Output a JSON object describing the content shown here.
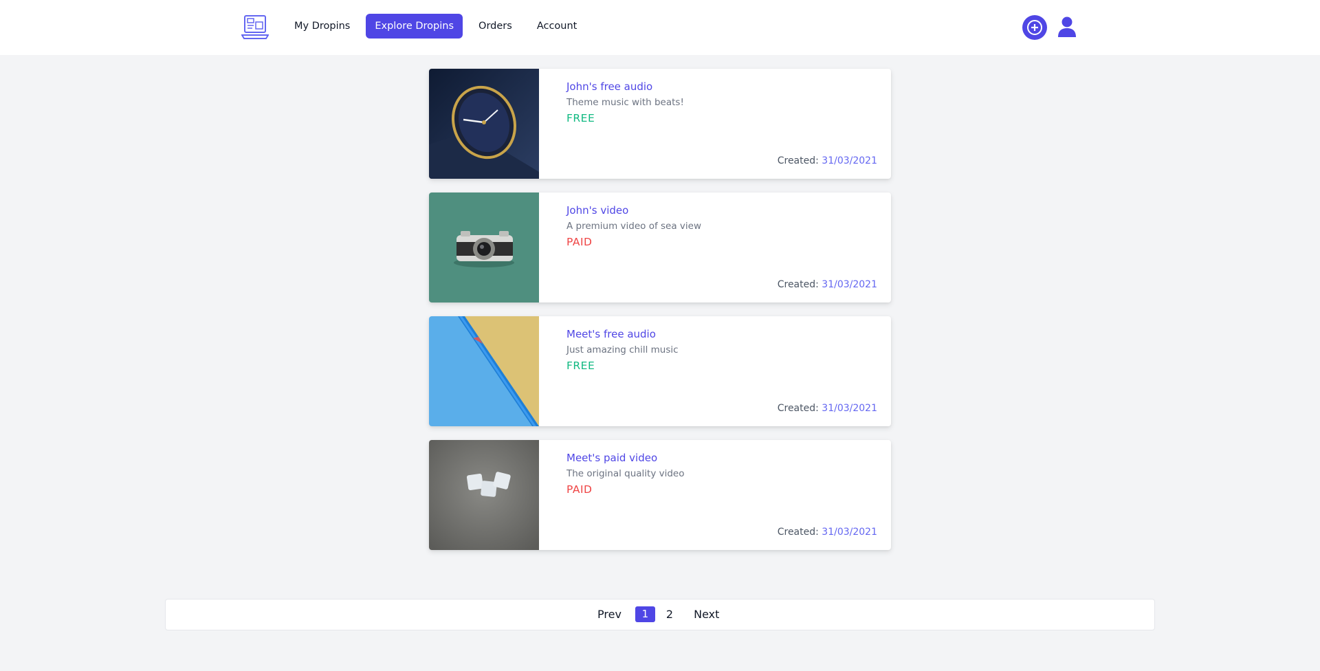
{
  "nav": {
    "links": [
      "My Dropins",
      "Explore Dropins",
      "Orders",
      "Account"
    ],
    "active": "Explore Dropins",
    "logo_icon": "laptop-icon",
    "add_icon": "plus-circle-icon",
    "user_icon": "user-icon"
  },
  "colors": {
    "accent": "#4f46e5",
    "free": "#10b981",
    "paid": "#ef4444",
    "date": "#6366f1"
  },
  "cards": [
    {
      "title": "John's free audio",
      "description": "Theme music with beats!",
      "price": "FREE",
      "created_label": "Created:",
      "created_date": "31/03/2021",
      "thumbnail": "watch"
    },
    {
      "title": "John's video",
      "description": "A premium video of sea view",
      "price": "PAID",
      "created_label": "Created:",
      "created_date": "31/03/2021",
      "thumbnail": "camera"
    },
    {
      "title": "Meet's free audio",
      "description": "Just amazing chill music",
      "price": "FREE",
      "created_label": "Created:",
      "created_date": "31/03/2021",
      "thumbnail": "pencil"
    },
    {
      "title": "Meet's paid video",
      "description": "The original quality video",
      "price": "PAID",
      "created_label": "Created:",
      "created_date": "31/03/2021",
      "thumbnail": "letter-tiles"
    }
  ],
  "pagination": {
    "prev": "Prev",
    "pages": [
      "1",
      "2"
    ],
    "current": "1",
    "next": "Next"
  }
}
